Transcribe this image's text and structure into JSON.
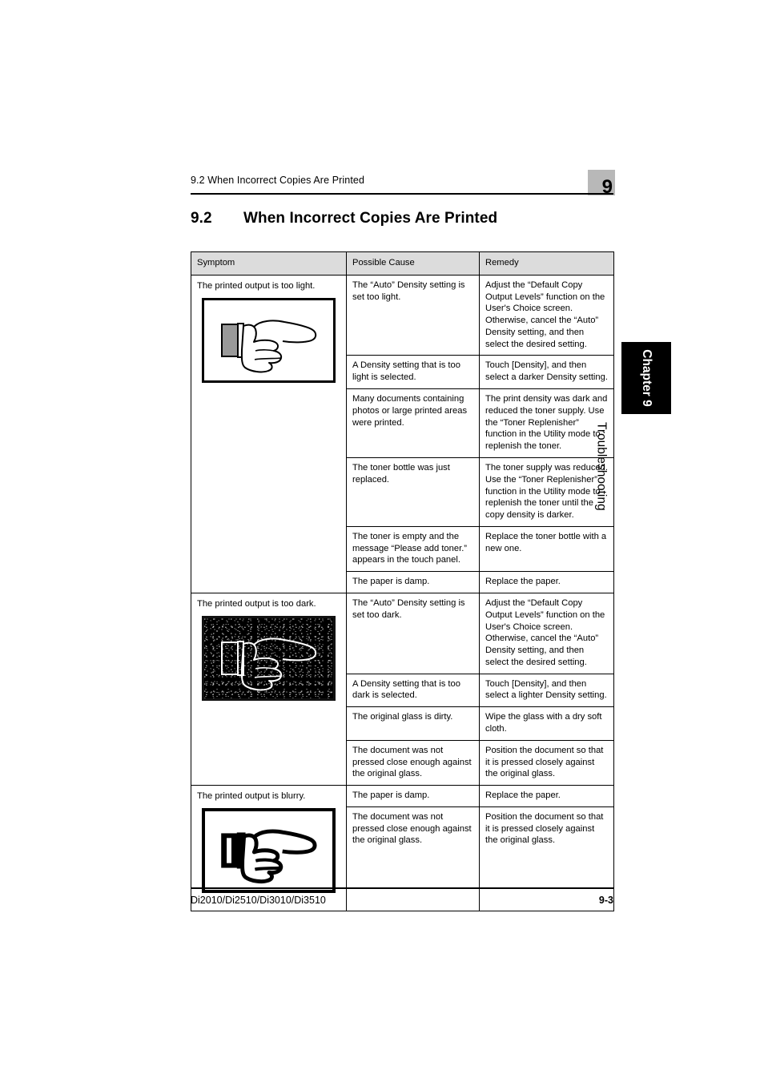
{
  "header": {
    "running_title": "9.2 When Incorrect Copies Are Printed",
    "chapter_badge": "9"
  },
  "section": {
    "number": "9.2",
    "title": "When Incorrect Copies Are Printed"
  },
  "side_tab": {
    "chapter_label": "Chapter 9",
    "chapter_name": "Troubleshooting"
  },
  "table": {
    "columns": [
      "Symptom",
      "Possible Cause",
      "Remedy"
    ],
    "groups": [
      {
        "symptom": "The printed output is too light.",
        "illustration": "pointing-hand-light",
        "rows": [
          {
            "cause": "The “Auto” Density setting is set too light.",
            "remedy": "Adjust the “Default Copy Output Levels” function on the User's Choice screen. Otherwise, cancel the “Auto” Density setting, and then select the desired setting."
          },
          {
            "cause": "A Density setting that is too light is selected.",
            "remedy": "Touch [Density], and then select a darker Density setting."
          },
          {
            "cause": "Many documents containing photos or large printed areas were printed.",
            "remedy": "The print density was dark and reduced the toner supply. Use the “Toner Replenisher” function in the Utility mode to replenish the toner."
          },
          {
            "cause": "The toner bottle was just replaced.",
            "remedy": "The toner supply was reduced. Use the “Toner Replenisher” function in the Utility mode to replenish the toner until the copy density is darker."
          },
          {
            "cause": "The toner is empty and the message “Please add toner.” appears in the touch panel.",
            "remedy": "Replace the toner bottle with a new one."
          },
          {
            "cause": "The paper is damp.",
            "remedy": "Replace the paper."
          }
        ]
      },
      {
        "symptom": "The printed output is too dark.",
        "illustration": "pointing-hand-dark",
        "rows": [
          {
            "cause": "The “Auto” Density setting is set too dark.",
            "remedy": "Adjust the “Default Copy Output Levels” function on the User's Choice screen. Otherwise, cancel the “Auto” Density setting, and then select the desired setting."
          },
          {
            "cause": "A Density setting that is too dark is selected.",
            "remedy": "Touch [Density], and then select a lighter Density setting."
          },
          {
            "cause": "The original glass is dirty.",
            "remedy": "Wipe the glass with a dry soft cloth."
          },
          {
            "cause": "The document was not pressed close enough against the original glass.",
            "remedy": "Position the document so that it is pressed closely against the original glass."
          }
        ]
      },
      {
        "symptom": "The printed output is blurry.",
        "illustration": "pointing-hand-blurry",
        "rows": [
          {
            "cause": "The paper is damp.",
            "remedy": "Replace the paper."
          },
          {
            "cause": "The document was not pressed close enough against the original glass.",
            "remedy": "Position the document so that it is pressed closely against the original glass."
          }
        ]
      }
    ]
  },
  "footer": {
    "model_line": "Di2010/Di2510/Di3010/Di3510",
    "page_number": "9-3"
  },
  "colors": {
    "header_badge_gray": "#b8b8b8",
    "table_header_gray": "#dcdcdc",
    "tab_black": "#000000",
    "text": "#000000"
  }
}
